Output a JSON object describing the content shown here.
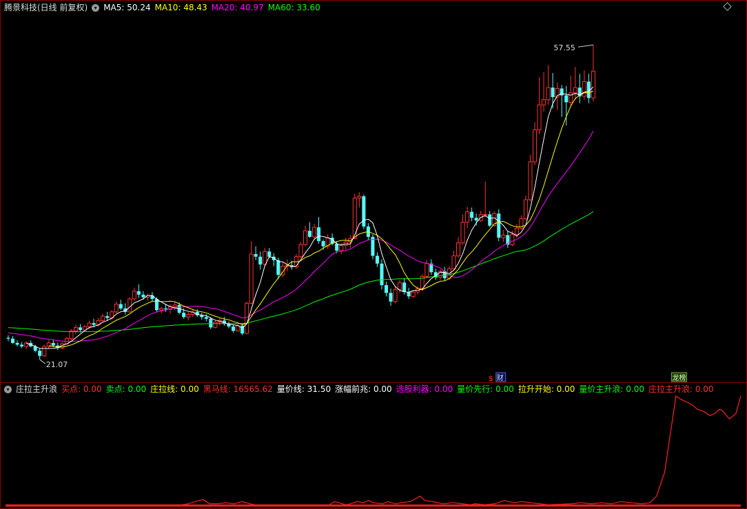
{
  "main_header": {
    "title": "腾景科技(日线 前复权)",
    "items": [
      {
        "label": "MA5: 50.24",
        "color": "#ffffff"
      },
      {
        "label": "MA10: 48.43",
        "color": "#ffff00"
      },
      {
        "label": "MA20: 40.97",
        "color": "#ff00ff"
      },
      {
        "label": "MA60: 33.60",
        "color": "#00ff00"
      }
    ]
  },
  "sub_header": {
    "title": "庄拉主升浪",
    "items": [
      {
        "label": "买点: 0.00",
        "color": "#ff3030"
      },
      {
        "label": "卖点: 0.00",
        "color": "#00ff00"
      },
      {
        "label": "庄拉线: 0.00",
        "color": "#ffff00"
      },
      {
        "label": "黑马线: 16565.62",
        "color": "#ff3030"
      },
      {
        "label": "量价线: 31.50",
        "color": "#ffffff"
      },
      {
        "label": "涨幅前兆: 0.00",
        "color": "#ffffff"
      },
      {
        "label": "选股利器: 0.00",
        "color": "#ff00ff"
      },
      {
        "label": "量价先行: 0.00",
        "color": "#00ff00"
      },
      {
        "label": "拉升开始: 0.00",
        "color": "#ffff00"
      },
      {
        "label": "量价主升浪: 0.00",
        "color": "#00ff00"
      },
      {
        "label": "庄拉主升浪: 0.00",
        "color": "#ff3030"
      }
    ]
  },
  "markers": {
    "cai": "财",
    "dollar": "$",
    "rank": "龙榜"
  },
  "chart_data": [
    {
      "type": "candlestick",
      "title": "腾景科技(日线 前复权)",
      "ylim": [
        19,
        61
      ],
      "annotations": {
        "high_label": "57.55",
        "low_label": "21.07"
      },
      "colors": {
        "up": "#ff3232",
        "down": "#54ffff",
        "ma5": "#ffffff",
        "ma10": "#ffff00",
        "ma20": "#ff00ff",
        "ma60": "#00ff00"
      },
      "candles": [
        [
          23.6,
          23.9,
          23.2,
          23.5
        ],
        [
          23.5,
          23.8,
          22.9,
          23.0
        ],
        [
          23.0,
          23.3,
          22.6,
          22.8
        ],
        [
          22.8,
          23.1,
          22.4,
          22.6
        ],
        [
          22.6,
          23.2,
          22.3,
          23.0
        ],
        [
          23.0,
          23.3,
          22.5,
          22.6
        ],
        [
          22.6,
          22.8,
          21.9,
          22.1
        ],
        [
          22.1,
          22.4,
          21.07,
          21.5
        ],
        [
          21.5,
          22.8,
          21.4,
          22.6
        ],
        [
          22.6,
          23.3,
          22.3,
          23.0
        ],
        [
          23.0,
          23.4,
          22.5,
          22.7
        ],
        [
          22.7,
          23.0,
          22.2,
          22.4
        ],
        [
          22.4,
          23.1,
          22.3,
          22.9
        ],
        [
          22.9,
          23.7,
          22.8,
          23.5
        ],
        [
          23.5,
          24.6,
          23.3,
          24.4
        ],
        [
          24.4,
          25.1,
          24.0,
          24.8
        ],
        [
          24.8,
          25.2,
          24.2,
          24.5
        ],
        [
          24.5,
          25.1,
          24.3,
          24.9
        ],
        [
          24.9,
          25.6,
          24.6,
          25.3
        ],
        [
          25.3,
          25.8,
          24.8,
          25.1
        ],
        [
          25.1,
          25.9,
          24.9,
          25.6
        ],
        [
          25.6,
          26.4,
          25.4,
          26.1
        ],
        [
          26.1,
          26.6,
          25.6,
          25.9
        ],
        [
          25.9,
          26.8,
          25.7,
          26.6
        ],
        [
          26.6,
          27.8,
          26.4,
          27.5
        ],
        [
          27.5,
          28.0,
          26.8,
          27.0
        ],
        [
          27.0,
          27.6,
          26.3,
          26.6
        ],
        [
          26.6,
          28.3,
          26.5,
          28.1
        ],
        [
          28.1,
          29.4,
          27.9,
          29.0
        ],
        [
          29.0,
          29.8,
          28.2,
          28.6
        ],
        [
          28.6,
          29.0,
          28.0,
          28.3
        ],
        [
          28.3,
          28.7,
          27.9,
          28.5
        ],
        [
          28.5,
          28.9,
          27.8,
          28.1
        ],
        [
          28.1,
          28.3,
          26.6,
          26.8
        ],
        [
          26.8,
          27.2,
          26.4,
          27.0
        ],
        [
          27.0,
          27.5,
          26.6,
          26.9
        ],
        [
          26.9,
          27.5,
          26.4,
          27.2
        ],
        [
          27.2,
          27.7,
          26.8,
          27.4
        ],
        [
          27.4,
          27.7,
          26.3,
          26.5
        ],
        [
          26.5,
          27.0,
          25.8,
          26.0
        ],
        [
          26.0,
          26.6,
          25.6,
          26.3
        ],
        [
          26.3,
          26.9,
          26.0,
          26.6
        ],
        [
          26.6,
          26.9,
          26.0,
          26.2
        ],
        [
          26.2,
          26.5,
          25.7,
          26.0
        ],
        [
          26.0,
          26.3,
          25.5,
          25.8
        ],
        [
          25.8,
          26.0,
          24.6,
          24.8
        ],
        [
          24.8,
          25.6,
          24.7,
          25.4
        ],
        [
          25.4,
          25.9,
          25.0,
          25.6
        ],
        [
          25.6,
          26.0,
          25.0,
          25.2
        ],
        [
          25.2,
          25.5,
          24.7,
          24.9
        ],
        [
          24.9,
          25.1,
          24.2,
          24.4
        ],
        [
          24.4,
          25.2,
          24.3,
          25.0
        ],
        [
          25.0,
          25.3,
          23.9,
          24.1
        ],
        [
          24.1,
          27.8,
          24.0,
          27.6
        ],
        [
          27.6,
          34.8,
          27.5,
          33.3
        ],
        [
          33.3,
          34.2,
          32.6,
          33.0
        ],
        [
          33.0,
          33.6,
          31.5,
          32.1
        ],
        [
          32.1,
          34.0,
          31.8,
          33.6
        ],
        [
          33.6,
          34.0,
          32.8,
          33.0
        ],
        [
          33.0,
          33.4,
          31.9,
          32.6
        ],
        [
          32.6,
          32.9,
          30.4,
          30.9
        ],
        [
          30.9,
          32.3,
          30.6,
          31.9
        ],
        [
          31.9,
          32.7,
          31.3,
          32.0
        ],
        [
          32.0,
          32.5,
          31.5,
          31.8
        ],
        [
          31.8,
          33.3,
          31.6,
          33.0
        ],
        [
          33.0,
          34.7,
          32.8,
          34.4
        ],
        [
          34.4,
          36.6,
          34.2,
          36.0
        ],
        [
          36.0,
          37.0,
          35.2,
          35.3
        ],
        [
          35.3,
          36.8,
          35.1,
          36.4
        ],
        [
          36.4,
          37.6,
          34.5,
          34.8
        ],
        [
          34.8,
          35.0,
          33.8,
          34.2
        ],
        [
          34.2,
          35.6,
          33.9,
          35.2
        ],
        [
          35.2,
          35.7,
          34.3,
          34.5
        ],
        [
          34.5,
          34.8,
          33.4,
          33.7
        ],
        [
          33.7,
          34.6,
          33.3,
          34.3
        ],
        [
          34.3,
          35.2,
          33.8,
          34.7
        ],
        [
          34.7,
          35.5,
          34.0,
          35.1
        ],
        [
          35.1,
          40.3,
          35.0,
          39.8
        ],
        [
          39.8,
          40.5,
          38.7,
          40.0
        ],
        [
          40.0,
          40.2,
          36.2,
          36.5
        ],
        [
          36.5,
          36.9,
          34.9,
          35.3
        ],
        [
          35.3,
          35.6,
          32.7,
          33.1
        ],
        [
          33.1,
          33.5,
          31.8,
          32.2
        ],
        [
          32.2,
          32.7,
          29.2,
          29.7
        ],
        [
          29.7,
          30.1,
          28.4,
          28.8
        ],
        [
          28.8,
          29.3,
          27.3,
          27.8
        ],
        [
          27.8,
          29.5,
          27.6,
          29.2
        ],
        [
          29.2,
          30.3,
          28.8,
          30.0
        ],
        [
          30.0,
          30.5,
          28.6,
          28.9
        ],
        [
          28.9,
          29.4,
          28.1,
          28.4
        ],
        [
          28.4,
          29.1,
          28.2,
          28.9
        ],
        [
          28.9,
          29.6,
          28.6,
          29.3
        ],
        [
          29.3,
          31.0,
          29.0,
          30.7
        ],
        [
          30.7,
          32.6,
          30.5,
          32.2
        ],
        [
          32.2,
          32.7,
          30.9,
          31.2
        ],
        [
          31.2,
          31.6,
          30.3,
          30.6
        ],
        [
          30.6,
          31.5,
          30.3,
          31.3
        ],
        [
          31.3,
          31.8,
          30.2,
          30.5
        ],
        [
          30.5,
          31.9,
          30.3,
          31.6
        ],
        [
          31.6,
          33.7,
          31.5,
          33.1
        ],
        [
          33.1,
          35.3,
          32.9,
          34.6
        ],
        [
          34.6,
          37.9,
          34.4,
          37.0
        ],
        [
          37.0,
          38.8,
          36.3,
          38.2
        ],
        [
          38.2,
          38.7,
          37.1,
          37.5
        ],
        [
          37.5,
          38.0,
          36.6,
          37.2
        ],
        [
          37.2,
          38.3,
          37.0,
          37.9
        ],
        [
          37.9,
          41.7,
          37.8,
          37.9
        ],
        [
          37.9,
          38.3,
          36.4,
          36.6
        ],
        [
          36.6,
          38.3,
          36.5,
          38.0
        ],
        [
          38.0,
          38.5,
          34.8,
          35.2
        ],
        [
          35.2,
          36.1,
          34.7,
          35.5
        ],
        [
          35.5,
          36.0,
          34.0,
          34.4
        ],
        [
          34.4,
          36.0,
          34.2,
          35.6
        ],
        [
          35.6,
          36.8,
          35.2,
          36.3
        ],
        [
          36.3,
          37.8,
          36.1,
          37.4
        ],
        [
          37.4,
          40.1,
          37.2,
          39.6
        ],
        [
          39.6,
          44.8,
          39.4,
          44.0
        ],
        [
          44.0,
          48.6,
          43.6,
          47.7
        ],
        [
          47.7,
          53.8,
          47.2,
          50.6
        ],
        [
          50.6,
          54.4,
          49.8,
          51.2
        ],
        [
          51.2,
          55.2,
          50.6,
          52.6
        ],
        [
          52.6,
          54.3,
          50.2,
          51.5
        ],
        [
          51.5,
          53.2,
          50.0,
          52.5
        ],
        [
          52.5,
          52.9,
          49.2,
          51.7
        ],
        [
          51.7,
          52.8,
          48.2,
          50.9
        ],
        [
          50.9,
          54.0,
          50.5,
          52.0
        ],
        [
          52.0,
          55.0,
          51.2,
          52.6
        ],
        [
          52.6,
          54.2,
          50.8,
          51.6
        ],
        [
          51.6,
          54.6,
          51.2,
          53.3
        ],
        [
          53.3,
          54.2,
          50.8,
          51.4
        ],
        [
          51.4,
          57.55,
          51.0,
          54.5
        ]
      ]
    },
    {
      "type": "line",
      "title": "庄拉主升浪",
      "series": [
        {
          "name": "黑马线",
          "color": "#ff2020",
          "segments": [
            [
              0,
              0
            ],
            [
              109,
              0
            ],
            [
              113,
              1
            ],
            [
              117,
              3
            ],
            [
              122,
              5
            ],
            [
              126,
              1
            ],
            [
              131,
              1
            ],
            [
              136,
              2
            ],
            [
              141,
              1
            ],
            [
              146,
              3
            ],
            [
              151,
              1
            ],
            [
              154,
              0
            ],
            [
              200,
              0
            ],
            [
              203,
              3
            ],
            [
              206,
              2
            ],
            [
              210,
              0
            ],
            [
              213,
              1
            ],
            [
              217,
              3
            ],
            [
              221,
              2
            ],
            [
              224,
              4
            ],
            [
              227,
              2
            ],
            [
              233,
              1
            ],
            [
              236,
              3
            ],
            [
              241,
              1
            ],
            [
              244,
              2
            ],
            [
              250,
              3
            ],
            [
              256,
              8
            ],
            [
              259,
              4
            ],
            [
              264,
              3
            ],
            [
              270,
              1
            ],
            [
              276,
              2
            ],
            [
              282,
              1
            ],
            [
              287,
              0
            ],
            [
              290,
              1
            ],
            [
              296,
              0
            ],
            [
              302,
              1
            ],
            [
              308,
              4
            ],
            [
              314,
              2
            ],
            [
              319,
              3
            ],
            [
              324,
              2
            ],
            [
              330,
              1
            ],
            [
              335,
              0
            ],
            [
              350,
              1
            ],
            [
              355,
              2
            ],
            [
              362,
              1
            ],
            [
              368,
              2
            ],
            [
              374,
              1
            ],
            [
              380,
              3
            ],
            [
              386,
              2
            ],
            [
              393,
              1
            ],
            [
              398,
              2
            ],
            [
              402,
              8
            ],
            [
              407,
              30
            ],
            [
              414,
              100
            ],
            [
              417,
              97
            ],
            [
              420,
              95
            ],
            [
              424,
              92
            ],
            [
              427,
              88
            ],
            [
              431,
              86
            ],
            [
              435,
              82
            ],
            [
              438,
              84
            ],
            [
              441,
              88
            ],
            [
              443,
              86
            ],
            [
              447,
              79
            ],
            [
              451,
              84
            ],
            [
              454,
              100
            ]
          ]
        }
      ]
    }
  ]
}
